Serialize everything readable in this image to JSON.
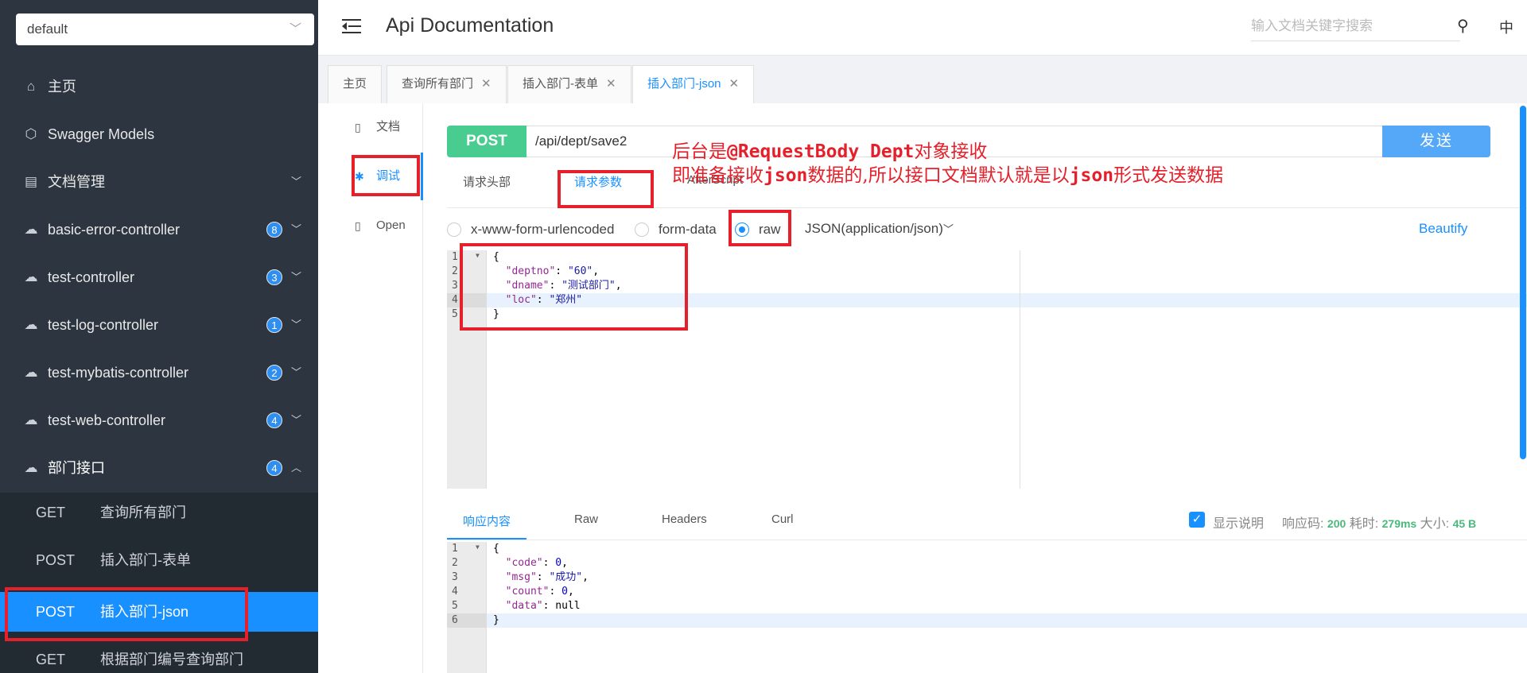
{
  "sidebar": {
    "group_select": "default",
    "items": [
      {
        "label": "主页",
        "icon": "home-icon"
      },
      {
        "label": "Swagger Models",
        "icon": "cube-icon"
      },
      {
        "label": "文档管理",
        "icon": "doc-manage-icon"
      },
      {
        "label": "basic-error-controller",
        "badge": "8",
        "icon": "cloud-icon"
      },
      {
        "label": "test-controller",
        "badge": "3",
        "icon": "cloud-icon"
      },
      {
        "label": "test-log-controller",
        "badge": "1",
        "icon": "cloud-icon"
      },
      {
        "label": "test-mybatis-controller",
        "badge": "2",
        "icon": "cloud-icon"
      },
      {
        "label": "test-web-controller",
        "badge": "4",
        "icon": "cloud-icon"
      },
      {
        "label": "部门接口",
        "badge": "4",
        "icon": "cloud-icon"
      }
    ],
    "sub_items": [
      {
        "method": "GET",
        "name": "查询所有部门"
      },
      {
        "method": "POST",
        "name": "插入部门-表单"
      },
      {
        "method": "POST",
        "name": "插入部门-json"
      },
      {
        "method": "GET",
        "name": "根据部门编号查询部门"
      }
    ]
  },
  "header": {
    "title": "Api Documentation",
    "search_placeholder": "输入文档关键字搜索",
    "lang": "中"
  },
  "tabs": [
    {
      "label": "主页"
    },
    {
      "label": "查询所有部门"
    },
    {
      "label": "插入部门-表单"
    },
    {
      "label": "插入部门-json"
    }
  ],
  "side_tabs": [
    {
      "label": "文档"
    },
    {
      "label": "调试"
    },
    {
      "label": "Open"
    }
  ],
  "request": {
    "method": "POST",
    "url": "/api/dept/save2",
    "send_label": "发送",
    "tabs": [
      "请求头部",
      "请求参数",
      "AfterScript"
    ],
    "body_types": [
      "x-www-form-urlencoded",
      "form-data",
      "raw"
    ],
    "content_type": "JSON(application/json)",
    "beautify": "Beautify",
    "line_numbers": [
      "1",
      "2",
      "3",
      "4",
      "5"
    ],
    "body": {
      "open": "{",
      "deptno_key": "\"deptno\"",
      "deptno_val": "\"60\"",
      "dname_key": "\"dname\"",
      "dname_val": "\"测试部门\"",
      "loc_key": "\"loc\"",
      "loc_val": "\"郑州\"",
      "close": "}"
    }
  },
  "response": {
    "tabs": [
      "响应内容",
      "Raw",
      "Headers",
      "Curl"
    ],
    "show_desc": "显示说明",
    "code_label": "响应码:",
    "code": "200",
    "time_label": "耗时:",
    "time": "279ms",
    "size_label": "大小:",
    "size": "45 B",
    "line_numbers": [
      "1",
      "2",
      "3",
      "4",
      "5",
      "6"
    ],
    "body": {
      "open": "{",
      "code_key": "\"code\"",
      "code_val": "0",
      "msg_key": "\"msg\"",
      "msg_val": "\"成功\"",
      "count_key": "\"count\"",
      "count_val": "0",
      "data_key": "\"data\"",
      "data_val": "null",
      "close": "}"
    }
  },
  "annotation": {
    "line1_prefix": "后台是",
    "line1_code": "@RequestBody Dept",
    "line1_suffix": "对象接收",
    "line2_a": "即准备接收",
    "line2_b": "json",
    "line2_c": "数据的,所以接口文档默认就是以",
    "line2_d": "json",
    "line2_e": "形式发送数据"
  },
  "colors": {
    "sidebar_bg": "#2d3640",
    "accent": "#1890ff",
    "post_green": "#49cc90",
    "annotation_red": "#e5202a"
  }
}
